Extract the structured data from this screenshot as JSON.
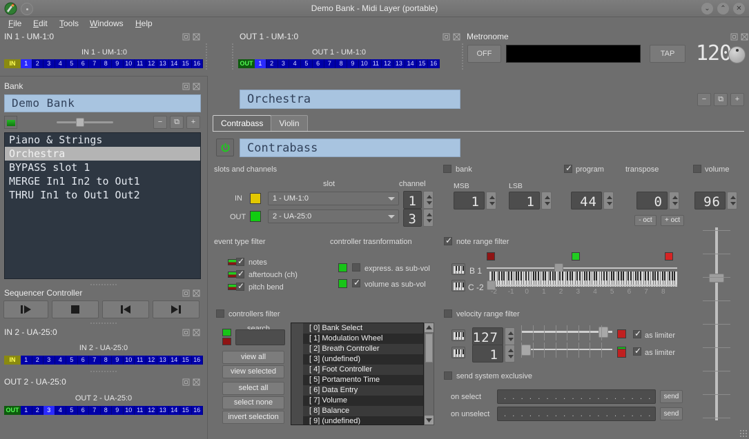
{
  "window": {
    "title": "Demo Bank - Midi Layer (portable)",
    "buttons": {
      "minimize": "⌄",
      "maximize": "⌃",
      "close": "✕"
    }
  },
  "menubar": [
    {
      "label": "File",
      "accel": "F"
    },
    {
      "label": "Edit",
      "accel": "E"
    },
    {
      "label": "Tools",
      "accel": "T"
    },
    {
      "label": "Windows",
      "accel": "W"
    },
    {
      "label": "Help",
      "accel": "H"
    }
  ],
  "ports": {
    "in1": {
      "dock_title": "IN 1 - UM-1:0",
      "strip_title": "IN 1 - UM-1:0",
      "tag": "IN",
      "channels": [
        "1",
        "2",
        "3",
        "4",
        "5",
        "6",
        "7",
        "8",
        "9",
        "10",
        "11",
        "12",
        "13",
        "14",
        "15",
        "16"
      ],
      "active_channel": 1
    },
    "out1": {
      "dock_title": "OUT 1 - UM-1:0",
      "strip_title": "OUT 1 - UM-1:0",
      "tag": "OUT",
      "channels": [
        "1",
        "2",
        "3",
        "4",
        "5",
        "6",
        "7",
        "8",
        "9",
        "10",
        "11",
        "12",
        "13",
        "14",
        "15",
        "16"
      ],
      "active_channel": 1
    },
    "in2": {
      "dock_title": "IN 2 - UA-25:0",
      "strip_title": "IN 2 - UA-25:0",
      "tag": "IN",
      "channels": [
        "1",
        "2",
        "3",
        "4",
        "5",
        "6",
        "7",
        "8",
        "9",
        "10",
        "11",
        "12",
        "13",
        "14",
        "15",
        "16"
      ],
      "active_channel": 0
    },
    "out2": {
      "dock_title": "OUT 2 - UA-25:0",
      "strip_title": "OUT 2 - UA-25:0",
      "tag": "OUT",
      "channels": [
        "1",
        "2",
        "3",
        "4",
        "5",
        "6",
        "7",
        "8",
        "9",
        "10",
        "11",
        "12",
        "13",
        "14",
        "15",
        "16"
      ],
      "active_channel": 3
    }
  },
  "metronome": {
    "title": "Metronome",
    "onoff_label": "OFF",
    "tap_label": "TAP",
    "bpm": "120"
  },
  "bank": {
    "title": "Bank",
    "name": "Demo Bank",
    "items": [
      "Piano & Strings",
      "Orchestra",
      "BYPASS slot 1",
      "MERGE In1 In2 to Out1",
      "THRU In1 to Out1 Out2"
    ],
    "selected_index": 1,
    "buttons": {
      "remove": "−",
      "duplicate": "⧉",
      "add": "+"
    }
  },
  "sequencer": {
    "title": "Sequencer Controller",
    "buttons": [
      "play",
      "stop",
      "rewind",
      "forward"
    ]
  },
  "editor": {
    "preset_name": "Orchestra",
    "preset_buttons": {
      "remove": "−",
      "duplicate": "⧉",
      "add": "+"
    },
    "tabs": [
      {
        "label": "Contrabass",
        "active": true
      },
      {
        "label": "Violin",
        "active": false
      }
    ],
    "layer_name": "Contrabass",
    "power_on": true,
    "slots_and_channels": {
      "group_label": "slots and channels",
      "col_slot": "slot",
      "col_channel": "channel",
      "in_label": "IN",
      "in_slot": "1 - UM-1:0",
      "in_channel": "1",
      "in_led_color": "#e3c800",
      "out_label": "OUT",
      "out_slot": "2 - UA-25:0",
      "out_channel": "3",
      "out_led_color": "#11cc11"
    },
    "bank_section": {
      "label": "bank",
      "checked": false,
      "msb_label": "MSB",
      "msb": "1",
      "lsb_label": "LSB",
      "lsb": "1"
    },
    "program_section": {
      "label": "program",
      "checked": true,
      "value": "44"
    },
    "transpose_section": {
      "label": "transpose",
      "value": "0",
      "minus_oct": "- oct",
      "plus_oct": "+ oct"
    },
    "volume_section": {
      "label": "volume",
      "checked": false,
      "value": "96"
    },
    "event_type_filter": {
      "label": "event type filter",
      "items": [
        {
          "label": "notes",
          "checked": true
        },
        {
          "label": "aftertouch (ch)",
          "checked": true
        },
        {
          "label": "pitch bend",
          "checked": true
        }
      ]
    },
    "controller_transformation": {
      "label": "controller trasnformation",
      "items": [
        {
          "label": "express. as sub-vol",
          "checked": false
        },
        {
          "label": "volume as sub-vol",
          "checked": true
        }
      ]
    },
    "note_range_filter": {
      "label": "note range filter",
      "checked": true,
      "high_note": "B 1",
      "low_note": "C -2",
      "octave_labels": [
        "-2",
        "-1",
        "0",
        "1",
        "2",
        "3",
        "4",
        "5",
        "6",
        "7",
        "8"
      ]
    },
    "velocity_range_filter": {
      "label": "velocity range filter",
      "checked": false,
      "high_value": "127",
      "low_value": "1",
      "high_limiter": {
        "label": "as limiter",
        "checked": true
      },
      "low_limiter": {
        "label": "as limiter",
        "checked": true
      }
    },
    "controllers_filter": {
      "label": "controllers filter",
      "checked": false,
      "search_label": "search",
      "search_value": "",
      "buttons": [
        "view all",
        "view selected",
        "select all",
        "select none",
        "invert selection"
      ],
      "items": [
        "[  0] Bank Select",
        "[  1] Modulation Wheel",
        "[  2] Breath Controller",
        "[  3] (undefined)",
        "[  4] Foot Controller",
        "[  5] Portamento Time",
        "[  6] Data Entry",
        "[  7] Volume",
        "[  8] Balance",
        "[  9] (undefined)"
      ]
    },
    "send_system_exclusive": {
      "label": "send system exclusive",
      "checked": false,
      "on_select_label": "on select",
      "on_select_value": ". .   . .   . .   . .   . .   . .   . .   . .   . .   . .   . .   . .",
      "on_unselect_label": "on unselect",
      "on_unselect_value": ". .   . .   . .   . .   . .   . .   . .   . .   . .   . .   . .   . .",
      "send_label": "send"
    }
  }
}
